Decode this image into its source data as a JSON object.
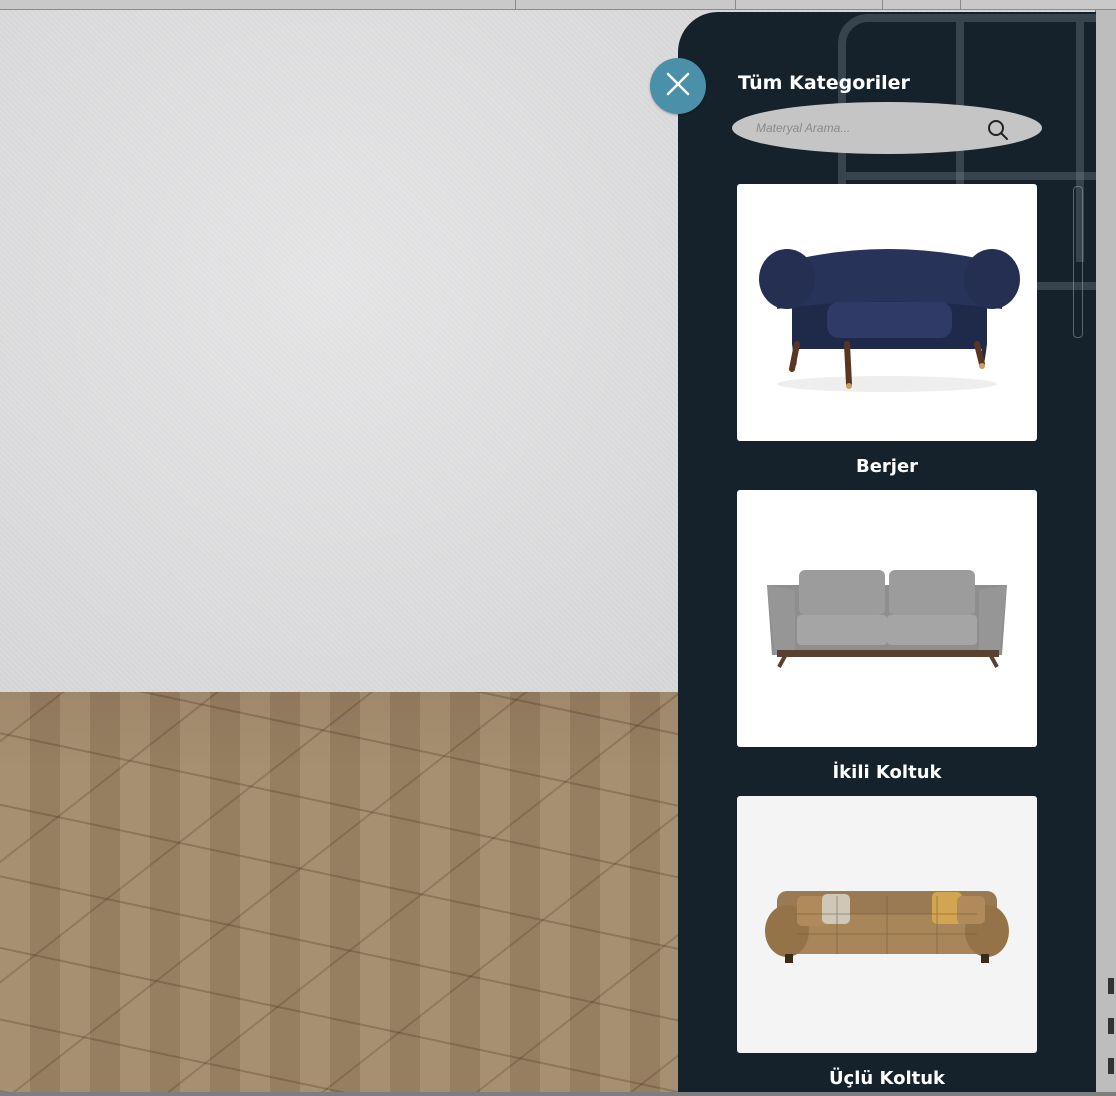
{
  "panel": {
    "title": "Tüm Kategoriler",
    "search_placeholder": "Materyal Arama..."
  },
  "categories": [
    {
      "label": "Berjer",
      "image": "chesterfield-armchair"
    },
    {
      "label": "İkili Koltuk",
      "image": "two-seat-sofa"
    },
    {
      "label": "Üçlü Koltuk",
      "image": "three-seat-sofa"
    }
  ],
  "icons": {
    "close": "close-icon",
    "search": "search-icon"
  },
  "colors": {
    "panel_bg": "#15222b",
    "close_button": "#4a90a8",
    "search_bg": "#c5c5c5"
  }
}
